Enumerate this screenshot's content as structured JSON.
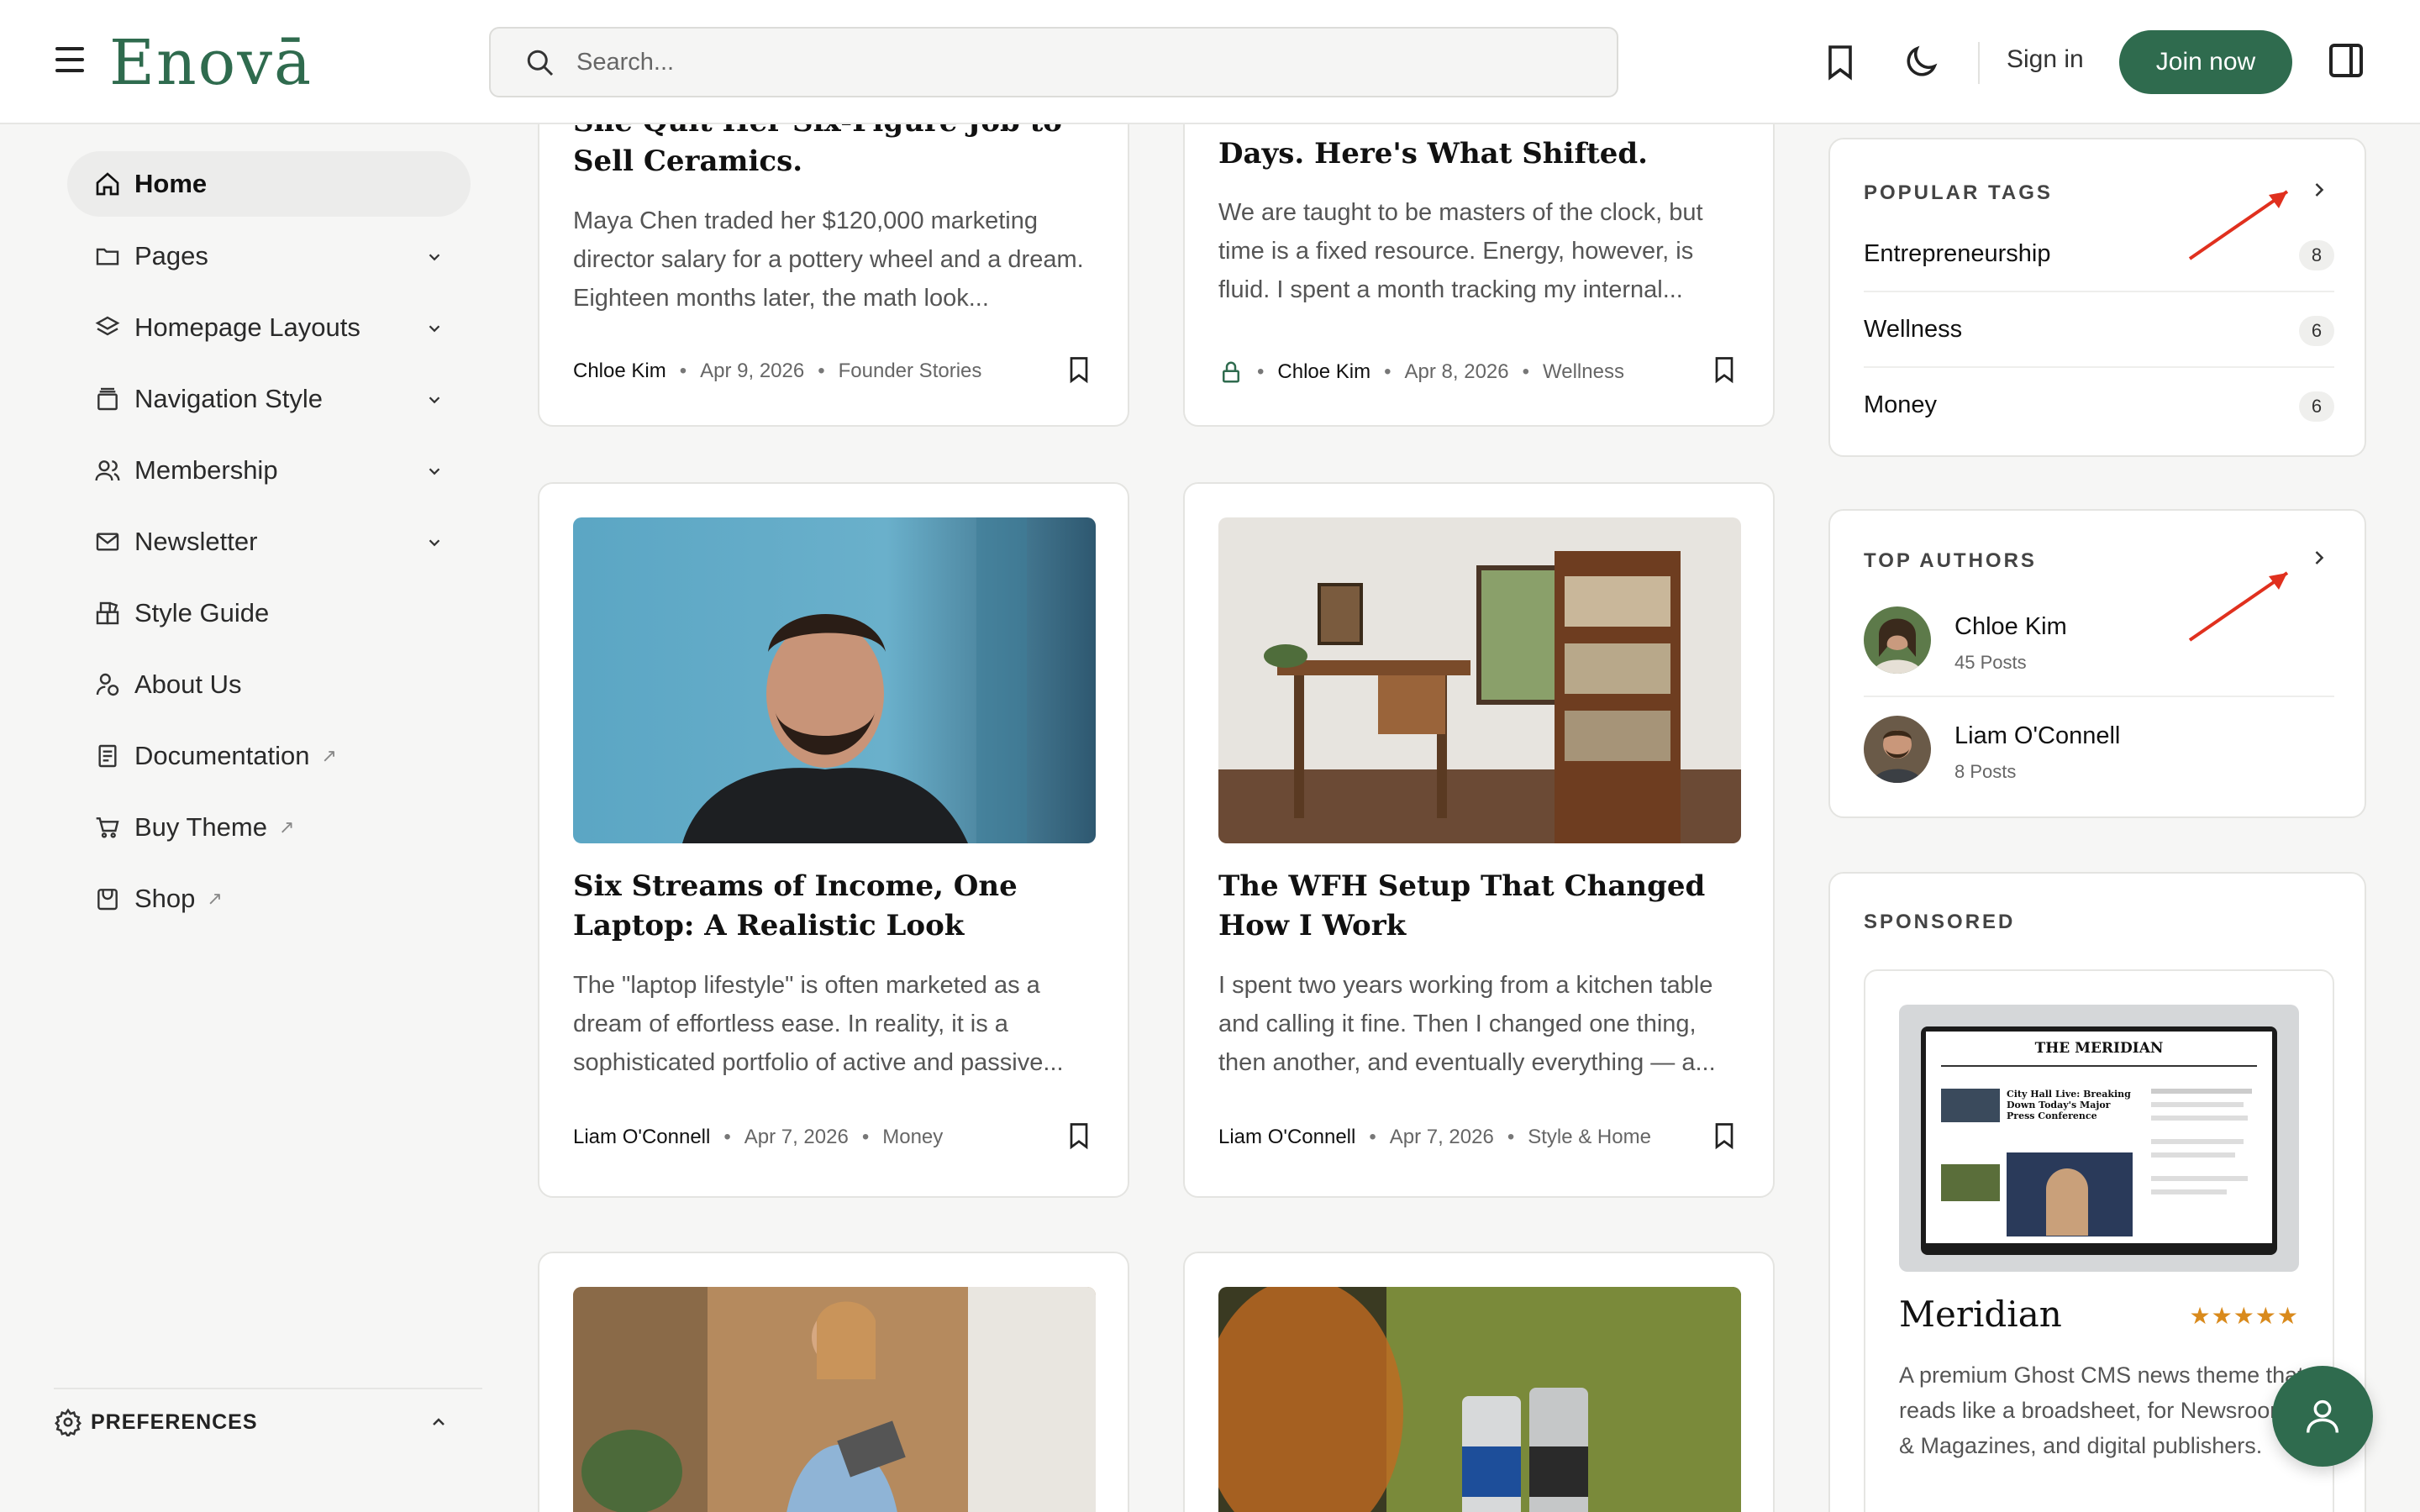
{
  "header": {
    "logo": "Enovā",
    "search_placeholder": "Search...",
    "sign_in": "Sign in",
    "join": "Join now"
  },
  "sidebar": {
    "items": [
      {
        "label": "Home",
        "icon": "home-icon"
      },
      {
        "label": "Pages",
        "icon": "folder-icon"
      },
      {
        "label": "Homepage Layouts",
        "icon": "layers-icon"
      },
      {
        "label": "Navigation Style",
        "icon": "navigation-icon"
      },
      {
        "label": "Membership",
        "icon": "users-icon"
      },
      {
        "label": "Newsletter",
        "icon": "mail-icon"
      },
      {
        "label": "Style Guide",
        "icon": "style-guide-icon"
      },
      {
        "label": "About Us",
        "icon": "about-icon"
      },
      {
        "label": "Documentation",
        "icon": "document-icon",
        "external": "↗"
      },
      {
        "label": "Buy Theme",
        "icon": "cart-icon",
        "external": "↗"
      },
      {
        "label": "Shop",
        "icon": "shop-icon",
        "external": "↗"
      }
    ],
    "preferences": "PREFERENCES"
  },
  "posts": [
    {
      "title": "She Quit Her Six-Figure Job to Sell Ceramics.",
      "excerpt": "Maya Chen traded her $120,000 marketing director salary for a pottery wheel and a dream. Eighteen months later, the math look...",
      "author": "Chloe Kim",
      "date": "Apr 9, 2026",
      "tag": "Founder Stories"
    },
    {
      "title": "Days. Here's What Shifted.",
      "excerpt": "We are taught to be masters of the clock, but time is a fixed resource. Energy, however, is fluid. I spent a month tracking my internal...",
      "author": "Chloe Kim",
      "date": "Apr 8, 2026",
      "tag": "Wellness"
    },
    {
      "title": "Six Streams of Income, One Laptop: A Realistic Look",
      "excerpt": "The \"laptop lifestyle\" is often marketed as a dream of effortless ease. In reality, it is a sophisticated portfolio of active and passive...",
      "author": "Liam O'Connell",
      "date": "Apr 7, 2026",
      "tag": "Money"
    },
    {
      "title": "The WFH Setup That Changed How I Work",
      "excerpt": "I spent two years working from a kitchen table and calling it fine. Then I changed one thing, then another, and eventually everything — a...",
      "author": "Liam O'Connell",
      "date": "Apr 7, 2026",
      "tag": "Style & Home"
    }
  ],
  "popular_tags": {
    "title": "POPULAR TAGS",
    "items": [
      {
        "name": "Entrepreneurship",
        "count": "8"
      },
      {
        "name": "Wellness",
        "count": "6"
      },
      {
        "name": "Money",
        "count": "6"
      }
    ]
  },
  "top_authors": {
    "title": "TOP AUTHORS",
    "items": [
      {
        "name": "Chloe Kim",
        "posts": "45 Posts"
      },
      {
        "name": "Liam O'Connell",
        "posts": "8 Posts"
      }
    ]
  },
  "sponsored": {
    "title": "SPONSORED",
    "product": "Meridian",
    "stars": "★★★★★",
    "desc": "A premium Ghost CMS news theme that reads like a broadsheet, for Newsrooms & Magazines, and digital publishers.",
    "mock_masthead": "THE MERIDIAN",
    "mock_headline": "City Hall Live: Breaking Down Today's Major Press Conference"
  },
  "colors": {
    "brand": "#2f6b4e",
    "annotation_arrow": "#e0301e",
    "star": "#d98a1c"
  }
}
